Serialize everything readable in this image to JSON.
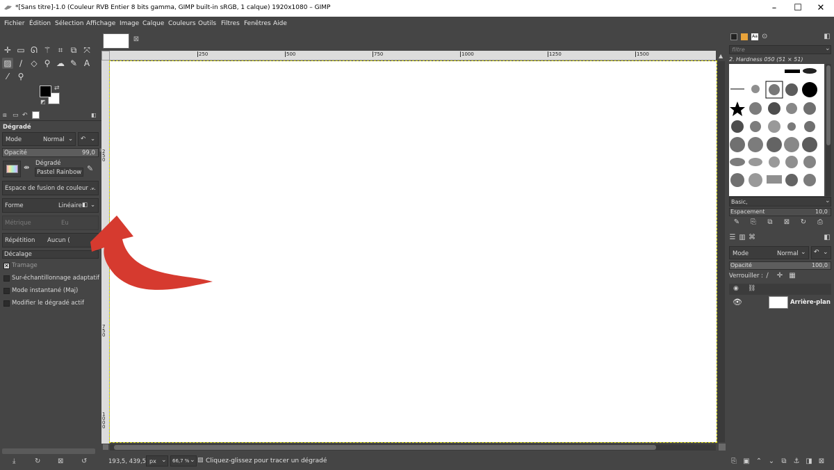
{
  "window": {
    "title": "*[Sans titre]-1.0 (Couleur RVB Entier 8 bits gamma, GIMP built-in sRGB, 1 calque) 1920x1080 – GIMP",
    "minimize_icon": "minimize-icon",
    "maximize_icon": "maximize-icon",
    "close_icon": "close-icon"
  },
  "menu": [
    "Fichier",
    "Édition",
    "Sélection",
    "Affichage",
    "Image",
    "Calque",
    "Couleurs",
    "Outils",
    "Filtres",
    "Fenêtres",
    "Aide"
  ],
  "tool_options": {
    "title": "Dégradé",
    "mode_label": "Mode",
    "mode_value": "Normal",
    "opacity_label": "Opacité",
    "opacity_value": "99,0",
    "gradient_label": "Dégradé",
    "gradient_value": "Pastel Rainbow",
    "blend_space": "Espace de fusion de couleur ...",
    "shape_label": "Forme",
    "shape_value": "Linéaire",
    "metric_label": "Métrique",
    "metric_value": "Eu",
    "repeat_label": "Répétition",
    "repeat_value": "Aucun (",
    "offset_label": "Décalage",
    "dither_label": "Tramage",
    "supersample_label": "Sur-échantillonnage adaptatif",
    "instant_label": "Mode instantané (Maj)",
    "modify_active_label": "Modifier le dégradé actif"
  },
  "rulers": {
    "h_ticks": [
      "250",
      "500",
      "750",
      "1000",
      "1250",
      "1500"
    ],
    "v_ticks": [
      "250",
      "750",
      "1000"
    ]
  },
  "status": {
    "coords": "193,5, 439,5",
    "unit": "px",
    "zoom": "66,7 %",
    "message": "Cliquez-glissez pour tracer un dégradé"
  },
  "brushes": {
    "filter_placeholder": "filtre",
    "current": "2. Hardness 050 (51 × 51)",
    "tag": "Basic,",
    "spacing_label": "Espacement",
    "spacing_value": "10,0"
  },
  "layers": {
    "mode_label": "Mode",
    "mode_value": "Normal",
    "opacity_label": "Opacité",
    "opacity_value": "100,0",
    "lock_label": "Verrouiller :",
    "layer_name": "Arrière-plan"
  },
  "colors": {
    "accent": "#d63a2f",
    "fg": "#000000",
    "bg": "#ffffff"
  }
}
